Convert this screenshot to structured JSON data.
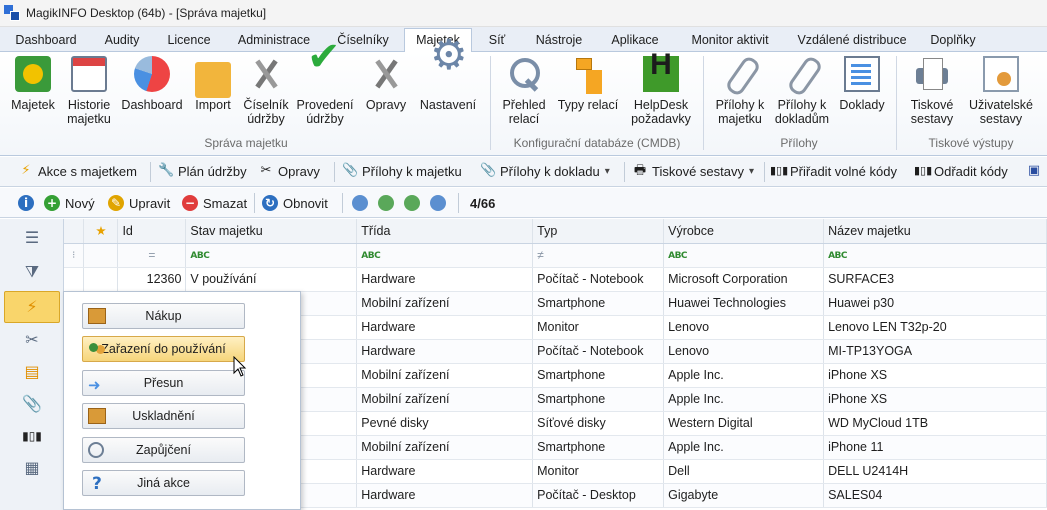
{
  "window": {
    "title": "MagikINFO Desktop (64b) - [Správa majetku]"
  },
  "tabs": [
    "Dashboard",
    "Audity",
    "Licence",
    "Administrace",
    "Číselníky",
    "Majetek",
    "Síť",
    "Nástroje",
    "Aplikace",
    "Monitor aktivit",
    "Vzdálené distribuce",
    "Doplňky"
  ],
  "active_tab": "Majetek",
  "ribbon": {
    "groups": {
      "sprava": "Správa majetku",
      "cmdb": "Konfigurační databáze (CMDB)",
      "prilohy": "Přílohy",
      "tisk": "Tiskové výstupy"
    },
    "buttons": {
      "majetek": [
        "Majetek",
        ""
      ],
      "historie": [
        "Historie",
        "majetku"
      ],
      "dashboard": [
        "Dashboard",
        ""
      ],
      "import": [
        "Import",
        ""
      ],
      "ciselnik": [
        "Číselník",
        "údržby"
      ],
      "provedeni": [
        "Provedení",
        "údržby"
      ],
      "opravy": [
        "Opravy",
        ""
      ],
      "nastaveni": [
        "Nastavení",
        ""
      ],
      "prehled": [
        "Přehled",
        "relací"
      ],
      "typy": [
        "Typy relací",
        ""
      ],
      "helpdesk": [
        "HelpDesk",
        "požadavky"
      ],
      "prilohy_majetek": [
        "Přílohy k",
        "majetku"
      ],
      "prilohy_doklad": [
        "Přílohy k",
        "dokladům"
      ],
      "doklady": [
        "Doklady",
        ""
      ],
      "tiskove": [
        "Tiskové",
        "sestavy"
      ],
      "uzivatelske": [
        "Uživatelské",
        "sestavy"
      ]
    }
  },
  "actionbar": {
    "akce": "Akce s majetkem",
    "plan": "Plán údržby",
    "opravy": "Opravy",
    "prilohy_majetek": "Přílohy k majetku",
    "prilohy_doklad": "Přílohy k dokladu",
    "tiskove": "Tiskové sestavy",
    "priradit": "Přiřadit volné kódy",
    "odradit": "Odřadit kódy"
  },
  "recordbar": {
    "novy": "Nový",
    "upravit": "Upravit",
    "smazat": "Smazat",
    "obnovit": "Obnovit",
    "counter": "4/66"
  },
  "grid": {
    "columns": [
      "Id",
      "Stav majetku",
      "Třída",
      "Typ",
      "Výrobce",
      "Název majetku"
    ],
    "filter_symbols": {
      "abc": "ABC",
      "eq": "=",
      "neq": "≠"
    },
    "rows": [
      {
        "id": "12360",
        "stav": "V používání",
        "trida": "Hardware",
        "typ": "Počítač - Notebook",
        "vyrobce": "Microsoft Corporation",
        "nazev": "SURFACE3"
      },
      {
        "id": "",
        "stav": "",
        "trida": "Mobilní zařízení",
        "typ": "Smartphone",
        "vyrobce": "Huawei Technologies",
        "nazev": "Huawei p30"
      },
      {
        "id": "",
        "stav": "",
        "trida": "Hardware",
        "typ": "Monitor",
        "vyrobce": "Lenovo",
        "nazev": "Lenovo LEN T32p-20"
      },
      {
        "id": "",
        "stav": "",
        "trida": "Hardware",
        "typ": "Počítač - Notebook",
        "vyrobce": "Lenovo",
        "nazev": "MI-TP13YOGA"
      },
      {
        "id": "",
        "stav": "",
        "trida": "Mobilní zařízení",
        "typ": "Smartphone",
        "vyrobce": "Apple Inc.",
        "nazev": "iPhone XS"
      },
      {
        "id": "",
        "stav": "",
        "trida": "Mobilní zařízení",
        "typ": "Smartphone",
        "vyrobce": "Apple Inc.",
        "nazev": "iPhone XS"
      },
      {
        "id": "",
        "stav": "",
        "trida": "Pevné disky",
        "typ": "Síťové disky",
        "vyrobce": "Western Digital",
        "nazev": "WD MyCloud 1TB"
      },
      {
        "id": "",
        "stav": "",
        "trida": "Mobilní zařízení",
        "typ": "Smartphone",
        "vyrobce": "Apple Inc.",
        "nazev": "iPhone 11"
      },
      {
        "id": "",
        "stav": "",
        "trida": "Hardware",
        "typ": "Monitor",
        "vyrobce": "Dell",
        "nazev": "DELL U2414H"
      },
      {
        "id": "",
        "stav": "",
        "trida": "Hardware",
        "typ": "Počítač - Desktop",
        "vyrobce": "Gigabyte",
        "nazev": "SALES04"
      }
    ]
  },
  "popup": {
    "items": [
      "Nákup",
      "Zařazení do používání",
      "Přesun",
      "Uskladnění",
      "Zapůjčení",
      "Jiná akce"
    ]
  },
  "colors": {
    "accent": "#2f6fd6",
    "active_sidebar": "#f9d56b",
    "hover_button": "#f6d57a"
  }
}
